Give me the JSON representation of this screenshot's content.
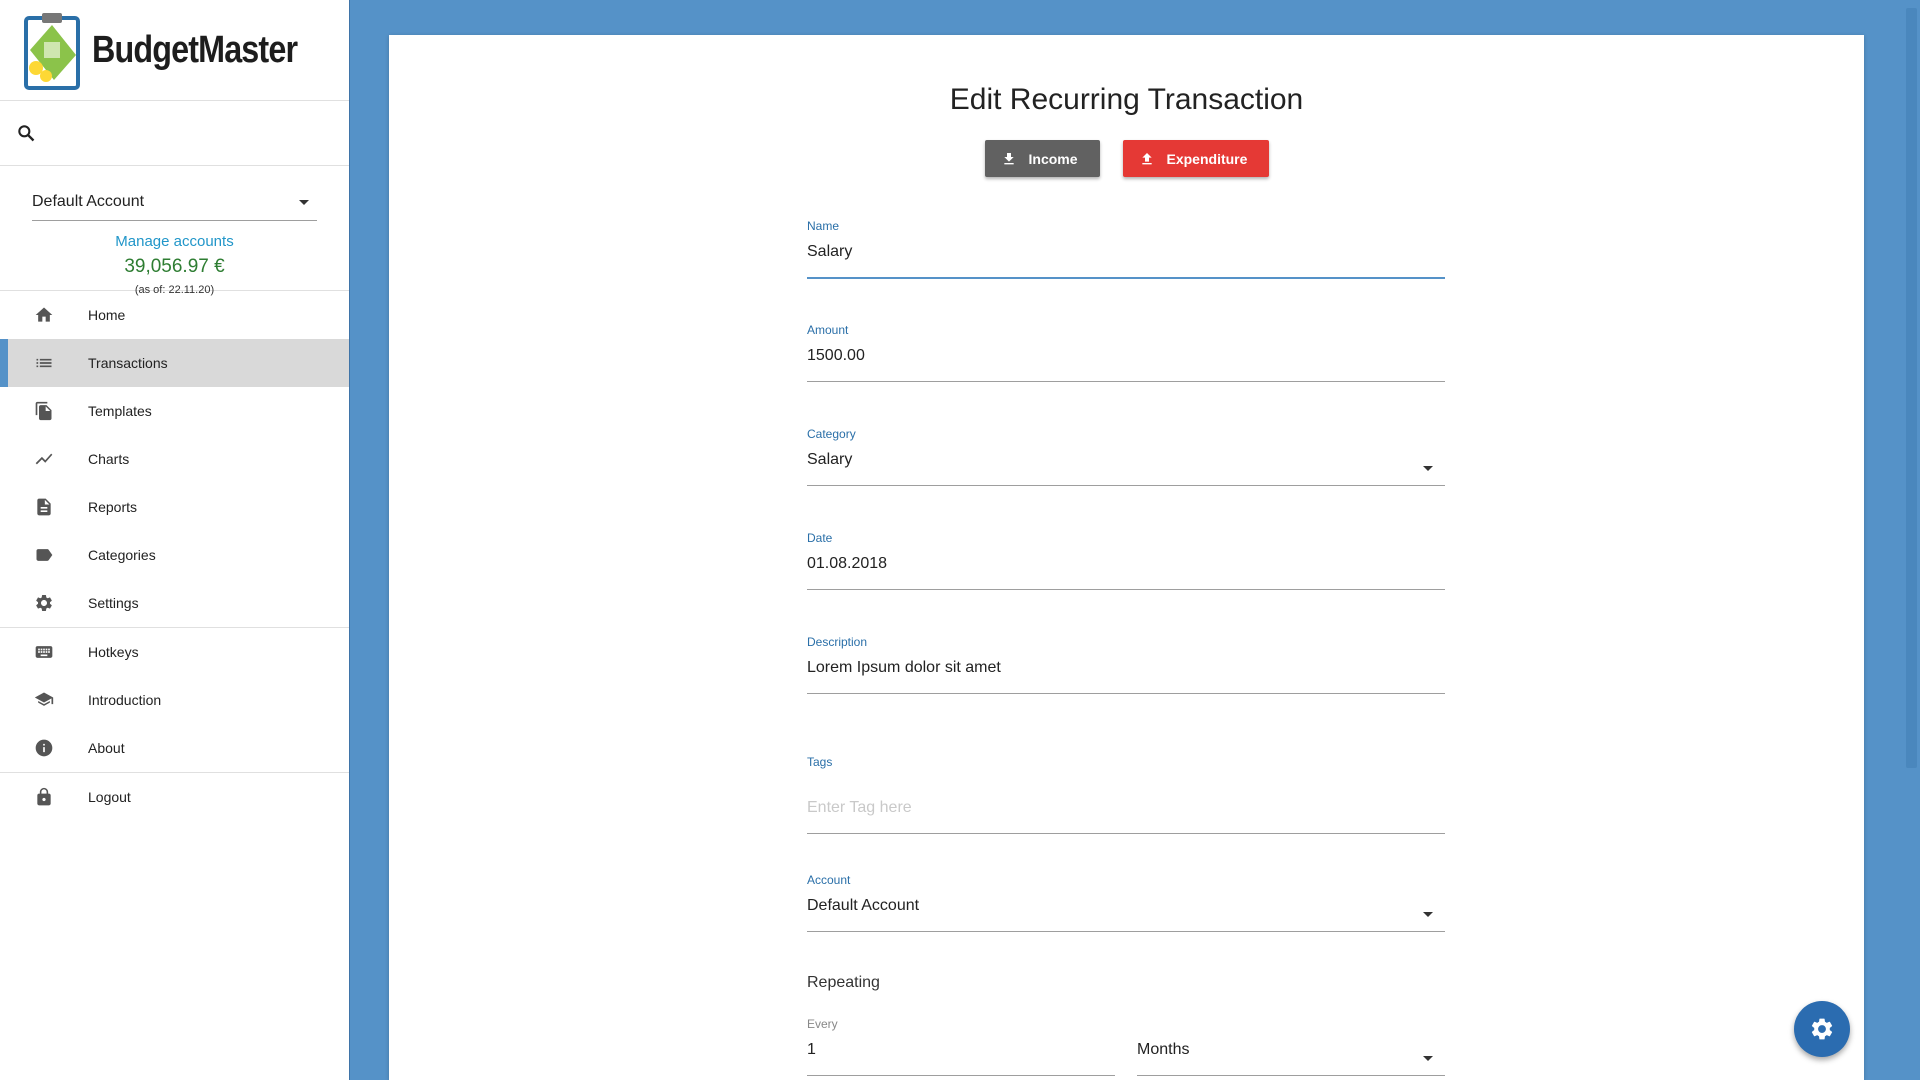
{
  "app": {
    "name": "BudgetMaster"
  },
  "account": {
    "selected": "Default Account",
    "manage_label": "Manage accounts",
    "balance": "39,056.97 €",
    "as_of": "(as of: 22.11.20)"
  },
  "nav": {
    "items": [
      {
        "label": "Home",
        "icon": "home-icon"
      },
      {
        "label": "Transactions",
        "icon": "list-icon"
      },
      {
        "label": "Templates",
        "icon": "file-copy-icon"
      },
      {
        "label": "Charts",
        "icon": "chart-line-icon"
      },
      {
        "label": "Reports",
        "icon": "document-icon"
      },
      {
        "label": "Categories",
        "icon": "label-icon"
      },
      {
        "label": "Settings",
        "icon": "gear-icon"
      },
      {
        "label": "Hotkeys",
        "icon": "keyboard-icon"
      },
      {
        "label": "Introduction",
        "icon": "graduation-cap-icon"
      },
      {
        "label": "About",
        "icon": "info-icon"
      },
      {
        "label": "Logout",
        "icon": "lock-icon"
      }
    ],
    "active": "Transactions"
  },
  "form": {
    "title": "Edit Recurring Transaction",
    "income_label": "Income",
    "expenditure_label": "Expenditure",
    "name": {
      "label": "Name",
      "value": "Salary"
    },
    "amount": {
      "label": "Amount",
      "value": "1500.00"
    },
    "category": {
      "label": "Category",
      "value": "Salary"
    },
    "date": {
      "label": "Date",
      "value": "01.08.2018"
    },
    "description": {
      "label": "Description",
      "value": "Lorem Ipsum dolor sit amet"
    },
    "tags": {
      "label": "Tags",
      "placeholder": "Enter Tag here"
    },
    "account": {
      "label": "Account",
      "value": "Default Account"
    },
    "repeating": {
      "label": "Repeating",
      "every_label": "Every",
      "every_value": "1",
      "unit": "Months"
    }
  },
  "colors": {
    "accent": "#5592c8",
    "income_btn": "#616161",
    "expenditure_btn": "#e53935",
    "balance": "#2e7d32",
    "link": "#2196c9"
  }
}
